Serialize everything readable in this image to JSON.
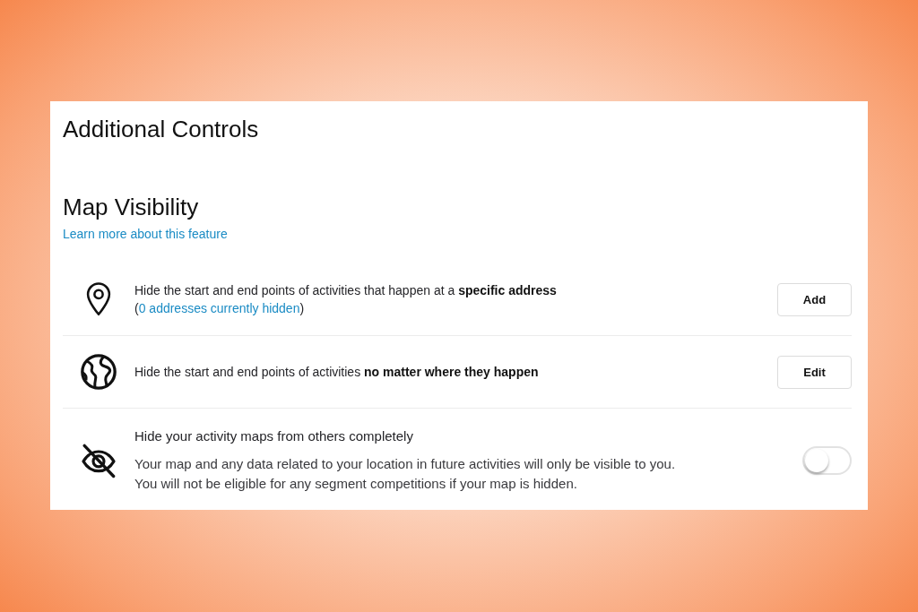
{
  "heading": "Additional Controls",
  "section": {
    "title": "Map Visibility",
    "link": "Learn more about this feature"
  },
  "settings": [
    {
      "kind": "button",
      "text": "Hide the start and end points of activities that happen at a **specific address**",
      "note": {
        "before": "(",
        "link": "0 addresses currently hidden",
        "after": ")"
      },
      "button": "Add"
    },
    {
      "kind": "button",
      "text": "Hide the start and end points of activities **no matter where they happen**",
      "button": "Edit"
    },
    {
      "kind": "toggle",
      "title": "Hide your activity maps from others completely",
      "description": [
        "Your map and any data related to your location in future activities will only be visible to you.",
        "You will not be eligible for any segment competitions if your map is hidden."
      ],
      "on": false
    }
  ]
}
